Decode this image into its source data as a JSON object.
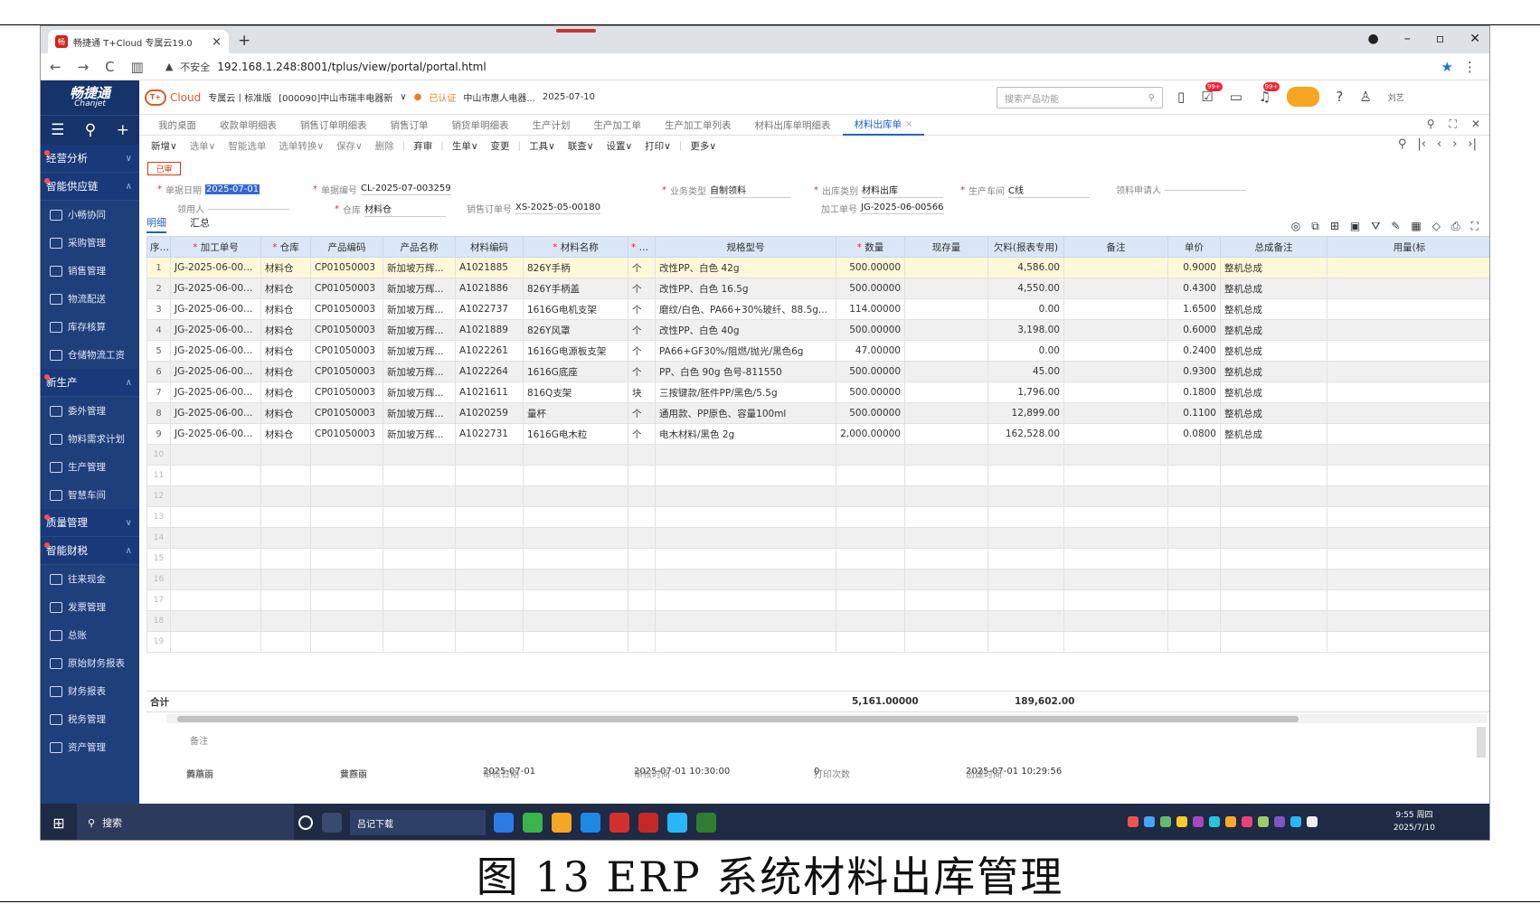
{
  "browser": {
    "tab_title": "畅捷通 T+Cloud 专属云19.0",
    "url_warning": "不安全",
    "url": "192.168.1.248:8001/tplus/view/portal/portal.html"
  },
  "app": {
    "logo_main": "畅捷通",
    "logo_sub": "Chanjet",
    "cloud_label": "Cloud",
    "edition": "专属云丨标准版",
    "company": "[000090]中山市瑞丰电器新",
    "verified": "已认证",
    "org": "中山市惠人电器...",
    "date": "2025-07-10",
    "search_placeholder": "搜索产品功能",
    "badge1": "99+",
    "badge2": "99+",
    "username": "刘艺"
  },
  "sidebar": [
    {
      "type": "group",
      "label": "经营分析",
      "arrow": "∨"
    },
    {
      "type": "group",
      "label": "智能供应链",
      "arrow": "∧"
    },
    {
      "type": "item",
      "label": "小畅协同"
    },
    {
      "type": "item",
      "label": "采购管理"
    },
    {
      "type": "item",
      "label": "销售管理"
    },
    {
      "type": "item",
      "label": "物流配送"
    },
    {
      "type": "item",
      "label": "库存核算"
    },
    {
      "type": "item",
      "label": "仓储物流工资"
    },
    {
      "type": "group",
      "label": "新生产",
      "arrow": "∧"
    },
    {
      "type": "item",
      "label": "委外管理"
    },
    {
      "type": "item",
      "label": "物料需求计划"
    },
    {
      "type": "item",
      "label": "生产管理"
    },
    {
      "type": "item",
      "label": "智慧车间"
    },
    {
      "type": "group",
      "label": "质量管理",
      "arrow": "∨"
    },
    {
      "type": "group",
      "label": "智能财税",
      "arrow": "∧"
    },
    {
      "type": "item",
      "label": "往来现金"
    },
    {
      "type": "item",
      "label": "发票管理"
    },
    {
      "type": "item",
      "label": "总账"
    },
    {
      "type": "item",
      "label": "原始财务报表"
    },
    {
      "type": "item",
      "label": "财务报表"
    },
    {
      "type": "item",
      "label": "税务管理"
    },
    {
      "type": "item",
      "label": "资产管理"
    }
  ],
  "page_tabs": [
    "我的桌面",
    "收款单明细表",
    "销售订单明细表",
    "销售订单",
    "销货单明细表",
    "生产计划",
    "生产加工单",
    "生产加工单列表",
    "材料出库单明细表",
    "材料出库单"
  ],
  "toolbar": [
    "新增∨",
    "选单∨",
    "智能选单",
    "选单转换∨",
    "保存∨",
    "删除",
    "弃审",
    "生单∨",
    "变更",
    "工具∨",
    "联查∨",
    "设置∨",
    "打印∨",
    "更多∨"
  ],
  "form": {
    "status": "已审",
    "doc_date_label": "单据日期",
    "doc_date": "2025-07-01",
    "doc_no_label": "单据编号",
    "doc_no": "CL-2025-07-003259",
    "biz_type_label": "业务类型",
    "biz_type": "自制领料",
    "out_type_label": "出库类别",
    "out_type": "材料出库",
    "workshop_label": "生产车间",
    "workshop": "C线",
    "requester_label": "领料申请人",
    "picker_label": "领用人",
    "warehouse_label": "仓库",
    "warehouse": "材料仓",
    "sales_order_label": "销售订单号",
    "sales_order": "XS-2025-05-00180",
    "work_order_label": "加工单号",
    "work_order": "JG-2025-06-00566"
  },
  "subtabs": [
    "明细",
    "汇总"
  ],
  "grid": {
    "columns": [
      "序号",
      "加工单号",
      "仓库",
      "产品编码",
      "产品名称",
      "材料编码",
      "材料名称",
      "计...",
      "规格型号",
      "数量",
      "现存量",
      "欠料(报表专用)",
      "备注",
      "单价",
      "总成备注",
      "用量(标"
    ],
    "required": [
      false,
      true,
      true,
      false,
      false,
      false,
      true,
      true,
      false,
      true,
      false,
      false,
      false,
      false,
      false,
      false
    ],
    "rows": [
      [
        "1",
        "JG-2025-06-005...",
        "材料仓",
        "CP01050003",
        "新加坡万辉...",
        "A1021885",
        "826Y手柄",
        "个",
        "改性PP、白色 42g",
        "500.00000",
        "",
        "4,586.00",
        "",
        "0.9000",
        "整机总成",
        ""
      ],
      [
        "2",
        "JG-2025-06-005...",
        "材料仓",
        "CP01050003",
        "新加坡万辉...",
        "A1021886",
        "826Y手柄盖",
        "个",
        "改性PP、白色 16.5g",
        "500.00000",
        "",
        "4,550.00",
        "",
        "0.4300",
        "整机总成",
        ""
      ],
      [
        "3",
        "JG-2025-06-005...",
        "材料仓",
        "CP01050003",
        "新加坡万辉...",
        "A1022737",
        "1616G电机支架",
        "个",
        "磨纹/白色、PA66+30%玻纤、88.5g...",
        "114.00000",
        "",
        "0.00",
        "",
        "1.6500",
        "整机总成",
        ""
      ],
      [
        "4",
        "JG-2025-06-005...",
        "材料仓",
        "CP01050003",
        "新加坡万辉...",
        "A1021889",
        "826Y风罩",
        "个",
        "改性PP、白色 40g",
        "500.00000",
        "",
        "3,198.00",
        "",
        "0.6000",
        "整机总成",
        ""
      ],
      [
        "5",
        "JG-2025-06-005...",
        "材料仓",
        "CP01050003",
        "新加坡万辉...",
        "A1022261",
        "1616G电源板支架",
        "个",
        "PA66+GF30%/阻燃/抛光/黑色6g",
        "47.00000",
        "",
        "0.00",
        "",
        "0.2400",
        "整机总成",
        ""
      ],
      [
        "6",
        "JG-2025-06-005...",
        "材料仓",
        "CP01050003",
        "新加坡万辉...",
        "A1022264",
        "1616G底座",
        "个",
        "PP、白色 90g 色号-811550",
        "500.00000",
        "",
        "45.00",
        "",
        "0.9300",
        "整机总成",
        ""
      ],
      [
        "7",
        "JG-2025-06-005...",
        "材料仓",
        "CP01050003",
        "新加坡万辉...",
        "A1021611",
        "816Q支架",
        "块",
        "三按键款/胚件PP/黑色/5.5g",
        "500.00000",
        "",
        "1,796.00",
        "",
        "0.1800",
        "整机总成",
        ""
      ],
      [
        "8",
        "JG-2025-06-005...",
        "材料仓",
        "CP01050003",
        "新加坡万辉...",
        "A1020259",
        "量杯",
        "个",
        "通用款、PP原色、容量100ml",
        "500.00000",
        "",
        "12,899.00",
        "",
        "0.1100",
        "整机总成",
        ""
      ],
      [
        "9",
        "JG-2025-06-005...",
        "材料仓",
        "CP01050003",
        "新加坡万辉...",
        "A1022731",
        "1616G电木粒",
        "个",
        "电木材料/黑色 2g",
        "2,000.00000",
        "",
        "162,528.00",
        "",
        "0.0800",
        "整机总成",
        ""
      ]
    ],
    "empty_rows": [
      "10",
      "11",
      "12",
      "13",
      "14",
      "15",
      "16",
      "17",
      "18",
      "19"
    ],
    "total_label": "合计",
    "total_qty": "5,161.00000",
    "total_owed": "189,602.00"
  },
  "note_label": "备注",
  "footer": {
    "maker_label": "制单人",
    "maker": "黄燕丽",
    "auditor_label": "审核人",
    "auditor": "黄燕丽",
    "audit_date_label": "审核日期",
    "audit_date": "2025-07-01",
    "audit_time_label": "审核时间",
    "audit_time": "2025-07-01 10:30:00",
    "print_count_label": "打印次数",
    "print_count": "0",
    "created_label": "创建时间",
    "created": "2025-07-01 10:29:56"
  },
  "taskbar": {
    "search": "搜索",
    "app1": "吕记下载",
    "time": "9:55 周四",
    "date": "2025/7/10"
  },
  "caption": "图 13 ERP 系统材料出库管理"
}
